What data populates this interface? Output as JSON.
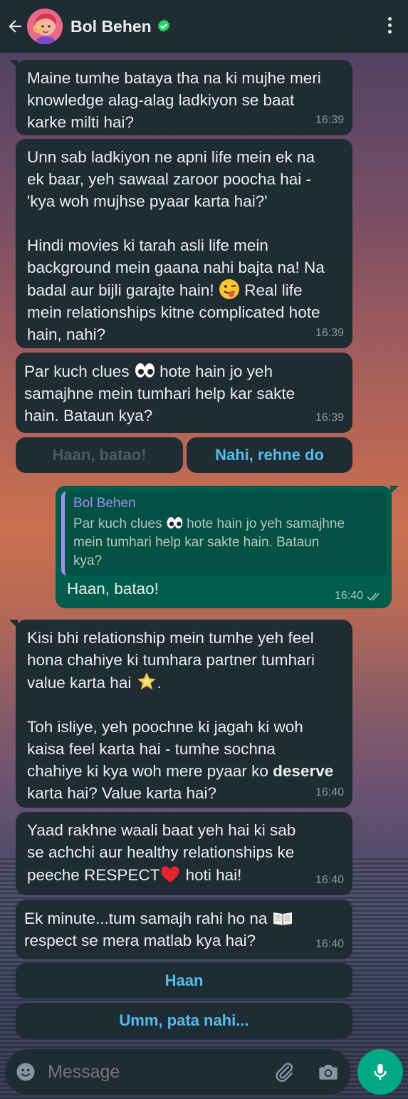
{
  "header": {
    "title": "Bol Behen",
    "back_icon": "arrow-left-icon",
    "verified_icon": "verified-check-icon",
    "menu_icon": "more-vert-icon"
  },
  "colors": {
    "header_bg": "#202c33",
    "incoming_bubble": "#202c33",
    "outgoing_bubble": "#005c4b",
    "link_blue": "#53bdeb",
    "accent_green": "#00a884",
    "quote_name": "#a68cf0"
  },
  "messages": [
    {
      "text": "Maine tumhe bataya tha na ki mujhe meri\nknowledge alag-alag ladkiyon se baat\nkarke milti hai?",
      "time": "16:39"
    },
    {
      "text_a": "Unn sab ladkiyon ne apni life mein ek na\nek baar, yeh sawaal zaroor poocha hai -\n'kya woh mujhse pyaar karta hai?'\n\nHindi movies ki tarah asli life mein\nbackground mein gaana nahi bajta na! Na\nbadal aur bijli garajte hain! ",
      "emoji": "winking-tongue-face-emoji",
      "text_b": " Real life\nmein relationships kitne complicated hote\nhain, nahi?",
      "time": "16:39"
    },
    {
      "text_a": "Par kuch clues ",
      "emoji": "eyes-emoji",
      "text_b": " hote hain jo yeh\nsamajhne mein tumhari help kar sakte\nhain. Bataun kya?",
      "time": "16:39"
    }
  ],
  "quick_replies_1": [
    "Haan, batao!",
    "Nahi, rehne do"
  ],
  "outgoing": {
    "quote_name": "Bol Behen",
    "quote_text_a": "Par kuch clues ",
    "quote_emoji": "eyes-emoji",
    "quote_text_b": " hote hain jo yeh samajhne\nmein tumhari help kar sakte hain. Bataun\nkya?",
    "text": "Haan, batao!",
    "time": "16:40",
    "status_icon": "double-check-icon"
  },
  "messages_2": [
    {
      "text_a": "Kisi bhi relationship mein tumhe yeh feel\nhona chahiye ki tumhara partner tumhari\nvalue karta hai ",
      "emoji": "glowing-star-emoji",
      "text_b": ".\n\nToh isliye, yeh poochne ki jagah ki woh\nkaisa feel karta hai - tumhe sochna\nchahiye ki kya woh mere pyaar ko ",
      "bold": "deserve",
      "text_c": "\nkarta hai? Value karta hai?",
      "time": "16:40"
    },
    {
      "text_a": "Yaad rakhne waali baat yeh hai ki sab\nse achchi aur healthy relationships ke\npeeche RESPECT",
      "emoji": "red-heart-emoji",
      "text_b": " hoti hai!",
      "time": "16:40"
    },
    {
      "text_a": "Ek minute...tum samajh rahi ho na ",
      "emoji": "open-book-emoji",
      "text_b": "\nrespect se mera matlab kya hai?",
      "time": "16:40"
    }
  ],
  "quick_replies_2": [
    "Haan",
    "Umm, pata nahi..."
  ],
  "composer": {
    "placeholder": "Message",
    "emoji_icon": "smiley-icon",
    "attach_icon": "paperclip-icon",
    "camera_icon": "camera-icon",
    "mic_icon": "microphone-icon"
  }
}
